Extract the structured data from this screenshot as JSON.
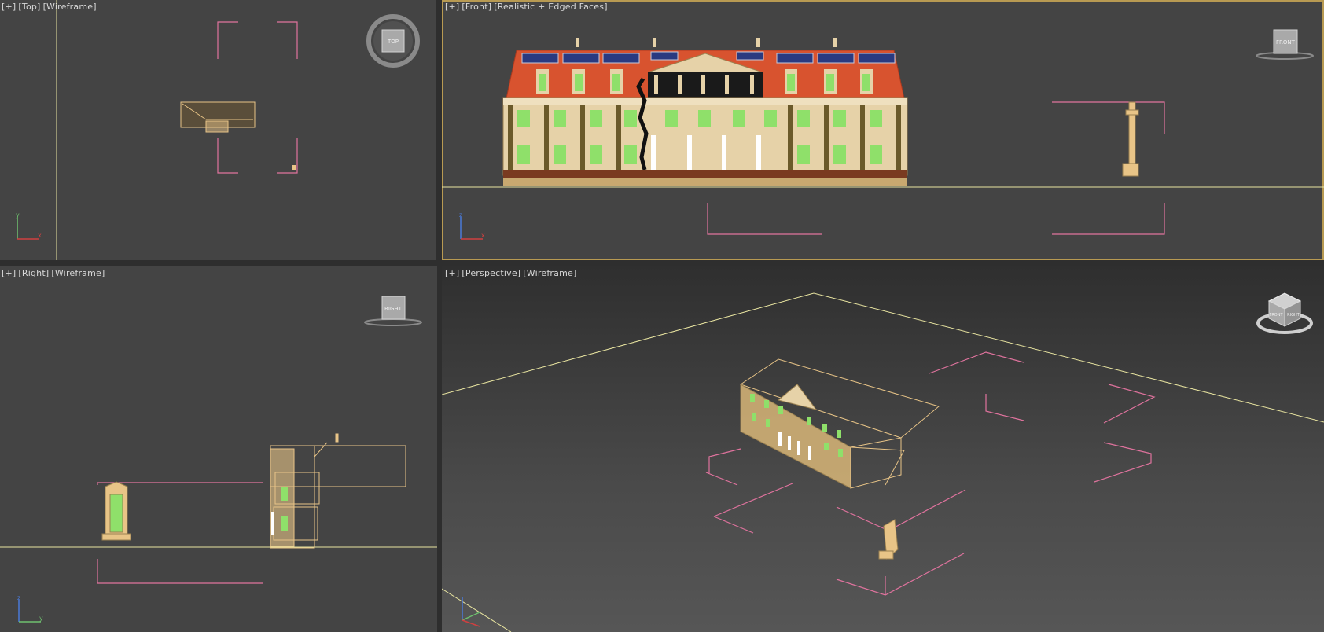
{
  "viewports": {
    "top": {
      "plus": "[+]",
      "view": "[Top]",
      "shading": "[Wireframe]",
      "cube_label": "TOP",
      "axis_v": "y",
      "axis_h": "x"
    },
    "front": {
      "plus": "[+]",
      "view": "[Front]",
      "shading": "[Realistic + Edged Faces]",
      "cube_label": "FRONT",
      "axis_v": "z",
      "axis_h": "x"
    },
    "right": {
      "plus": "[+]",
      "view": "[Right]",
      "shading": "[Wireframe]",
      "cube_label": "RIGHT",
      "axis_v": "z",
      "axis_h": "y"
    },
    "perspective": {
      "plus": "[+]",
      "view": "[Perspective]",
      "shading": "[Wireframe]",
      "cube_face_1": "FRONT",
      "cube_face_2": "RIGHT"
    }
  },
  "colors": {
    "viewport_bg": "#444444",
    "active_border": "#b89a52",
    "grid_line": "#e8e4a0",
    "selection_bracket": "#e0739e",
    "building_wire": "#e8c487",
    "roof": "#d8532f",
    "facade": "#e6d2a8",
    "window_glow": "#8fe06a"
  },
  "icons": {
    "viewcube": "viewcube-icon",
    "axis_tripod": "axis-tripod-icon"
  }
}
